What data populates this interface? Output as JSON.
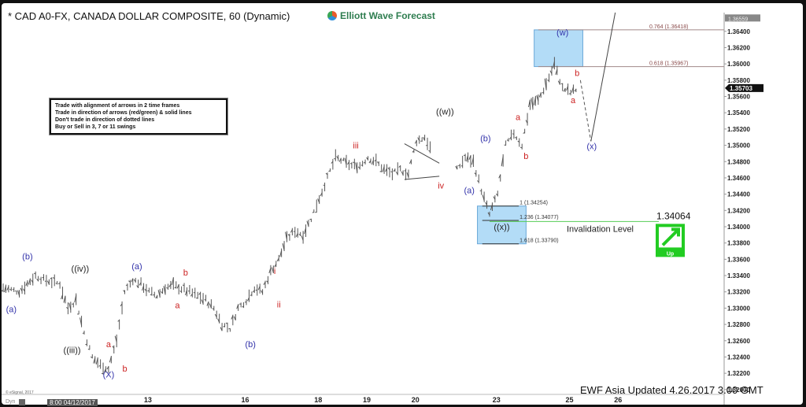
{
  "window": {
    "title": "* CAD A0-FX, CANADA DOLLAR COMPOSITE, 60 (Dynamic)",
    "brand": "Elliott Wave Forecast",
    "copyright": "© eSignal, 2017",
    "dyn_label": "Dyn",
    "cursor_date": "8:00 04/12/2017",
    "footer_note": "EWF Asia Updated 4.26.2017 3.00 GMT"
  },
  "rules_box": [
    "Trade with alignment of arrows in 2 time frames",
    "Trade in direction of arrows (red/green) & solid lines",
    "Don't trade in direction of dotted lines",
    "Buy or Sell in 3, 7 or 11 swings"
  ],
  "chart_data": {
    "type": "bar",
    "subtype": "ohlc-hourly",
    "title": "* CAD A0-FX, CANADA DOLLAR COMPOSITE, 60 (Dynamic)",
    "ylim": [
      1.3195,
      1.3663
    ],
    "y_ticks": [
      "1.36400",
      "1.36200",
      "1.36000",
      "1.35800",
      "1.35600",
      "1.35400",
      "1.35200",
      "1.35000",
      "1.34800",
      "1.34600",
      "1.34400",
      "1.34200",
      "1.34000",
      "1.33800",
      "1.33600",
      "1.33400",
      "1.33200",
      "1.33000",
      "1.32800",
      "1.32600",
      "1.32400",
      "1.32200",
      "1.32000"
    ],
    "x_ticks": [
      {
        "label": "13",
        "idx": 13
      },
      {
        "label": "16",
        "idx": 25
      },
      {
        "label": "18",
        "idx": 34
      },
      {
        "label": "19",
        "idx": 40
      },
      {
        "label": "20",
        "idx": 46
      },
      {
        "label": "23",
        "idx": 56
      },
      {
        "label": "25",
        "idx": 65
      },
      {
        "label": "26",
        "idx": 71
      }
    ],
    "price_path": [
      [
        0,
        1.3325
      ],
      [
        2,
        1.332
      ],
      [
        4,
        1.334
      ],
      [
        5,
        1.3335
      ],
      [
        7,
        1.333
      ],
      [
        8,
        1.33
      ],
      [
        9,
        1.331
      ],
      [
        10,
        1.327
      ],
      [
        11,
        1.324
      ],
      [
        12,
        1.323
      ],
      [
        13,
        1.3225
      ],
      [
        14,
        1.326
      ],
      [
        15,
        1.332
      ],
      [
        16,
        1.3335
      ],
      [
        17,
        1.333
      ],
      [
        18,
        1.332
      ],
      [
        19,
        1.3315
      ],
      [
        20,
        1.3325
      ],
      [
        21,
        1.3328
      ],
      [
        23,
        1.332
      ],
      [
        24,
        1.3315
      ],
      [
        25,
        1.331
      ],
      [
        26,
        1.33
      ],
      [
        27,
        1.328
      ],
      [
        28,
        1.3275
      ],
      [
        29,
        1.33
      ],
      [
        30,
        1.331
      ],
      [
        31,
        1.3325
      ],
      [
        32,
        1.332
      ],
      [
        33,
        1.3345
      ],
      [
        34,
        1.336
      ],
      [
        35,
        1.3385
      ],
      [
        36,
        1.3395
      ],
      [
        37,
        1.339
      ],
      [
        38,
        1.341
      ],
      [
        39,
        1.3435
      ],
      [
        40,
        1.346
      ],
      [
        41,
        1.3485
      ],
      [
        42,
        1.348
      ],
      [
        43,
        1.3475
      ],
      [
        44,
        1.3475
      ],
      [
        45,
        1.3485
      ],
      [
        46,
        1.348
      ],
      [
        47,
        1.347
      ],
      [
        48,
        1.3465
      ],
      [
        49,
        1.347
      ],
      [
        50,
        1.3465
      ],
      [
        51,
        1.3505
      ],
      [
        52,
        1.351
      ],
      [
        53,
        1.349
      ],
      [
        56,
        1.347
      ],
      [
        57,
        1.3485
      ],
      [
        58,
        1.348
      ],
      [
        59,
        1.3445
      ],
      [
        60,
        1.3415
      ],
      [
        61,
        1.344
      ],
      [
        62,
        1.35
      ],
      [
        63,
        1.3515
      ],
      [
        64,
        1.35
      ],
      [
        65,
        1.355
      ],
      [
        66,
        1.3555
      ],
      [
        67,
        1.3575
      ],
      [
        68,
        1.36
      ],
      [
        69,
        1.357
      ],
      [
        70,
        1.3565
      ],
      [
        71,
        1.357
      ]
    ],
    "current_price": {
      "label": "1.35703",
      "value": 1.35703
    },
    "last_high": {
      "label": "1.36559",
      "value": 1.36559
    },
    "fib_levels": [
      {
        "label": "0.764 (1.36418)",
        "value": 1.36418
      },
      {
        "label": "0.618 (1.35967)",
        "value": 1.35967
      },
      {
        "label": "1 (1.34254)",
        "value": 1.34254
      },
      {
        "label": "1.236 (1.34077)",
        "value": 1.34077
      },
      {
        "label": "1.618 (1.33790)",
        "value": 1.3379
      }
    ],
    "zones": [
      {
        "name": "w-target-zone",
        "from_idx": 65.5,
        "to_idx": 71.5,
        "low": 1.35967,
        "high": 1.36418
      },
      {
        "name": "xx-buy-zone",
        "from_idx": 58.5,
        "to_idx": 64.5,
        "low": 1.3379,
        "high": 1.34254
      }
    ],
    "invalidation": {
      "label": "Invalidation Level",
      "value_label": "1.34064",
      "value": 1.34064,
      "direction": "Up",
      "color": "#22cc22"
    },
    "projection": {
      "dashed": [
        [
          71.2,
          1.358
        ],
        [
          72.5,
          1.3505
        ]
      ],
      "solid": [
        [
          72.5,
          1.3505
        ],
        [
          75.5,
          1.3665
        ]
      ]
    },
    "triangle": {
      "upper": [
        [
          49.5,
          1.3502
        ],
        [
          53.8,
          1.3478
        ]
      ],
      "lower": [
        [
          49.5,
          1.3458
        ],
        [
          53.8,
          1.3462
        ]
      ]
    },
    "wave_labels": [
      {
        "text": "(a)",
        "idx": 1,
        "value": 1.3295,
        "color": "#3333aa"
      },
      {
        "text": "(b)",
        "idx": 3,
        "value": 1.336,
        "color": "#3333aa"
      },
      {
        "text": "((iv))",
        "idx": 9.5,
        "value": 1.3345,
        "color": "#222222"
      },
      {
        "text": "((iii))",
        "idx": 8.5,
        "value": 1.3245,
        "color": "#222222"
      },
      {
        "text": "a",
        "idx": 13,
        "value": 1.3252,
        "color": "#cc2222"
      },
      {
        "text": "(X)",
        "idx": 13,
        "value": 1.3215,
        "color": "#3333aa"
      },
      {
        "text": "b",
        "idx": 15,
        "value": 1.3222,
        "color": "#cc2222"
      },
      {
        "text": "(a)",
        "idx": 16.5,
        "value": 1.3348,
        "color": "#3333aa"
      },
      {
        "text": "b",
        "idx": 22.5,
        "value": 1.334,
        "color": "#cc2222"
      },
      {
        "text": "a",
        "idx": 21.5,
        "value": 1.33,
        "color": "#cc2222"
      },
      {
        "text": "(b)",
        "idx": 30.5,
        "value": 1.3252,
        "color": "#3333aa"
      },
      {
        "text": "i",
        "idx": 33.5,
        "value": 1.3342,
        "color": "#cc2222"
      },
      {
        "text": "ii",
        "idx": 34,
        "value": 1.3301,
        "color": "#cc2222"
      },
      {
        "text": "iii",
        "idx": 43.5,
        "value": 1.3496,
        "color": "#cc2222"
      },
      {
        "text": "iv",
        "idx": 54,
        "value": 1.3447,
        "color": "#cc2222"
      },
      {
        "text": "((w))",
        "idx": 54.5,
        "value": 1.3538,
        "color": "#222222"
      },
      {
        "text": "(a)",
        "idx": 57.5,
        "value": 1.3441,
        "color": "#3333aa"
      },
      {
        "text": "(b)",
        "idx": 59.5,
        "value": 1.3505,
        "color": "#3333aa"
      },
      {
        "text": "((x))",
        "idx": 61.5,
        "value": 1.3396,
        "color": "#222222"
      },
      {
        "text": "a",
        "idx": 63.5,
        "value": 1.3531,
        "color": "#cc2222"
      },
      {
        "text": "b",
        "idx": 64.5,
        "value": 1.3483,
        "color": "#cc2222"
      },
      {
        "text": "(w)",
        "idx": 69,
        "value": 1.3635,
        "color": "#3333aa"
      },
      {
        "text": "b",
        "idx": 70.8,
        "value": 1.3585,
        "color": "#cc2222"
      },
      {
        "text": "a",
        "idx": 70.3,
        "value": 1.3552,
        "color": "#cc2222"
      },
      {
        "text": "(x)",
        "idx": 72.6,
        "value": 1.3495,
        "color": "#3333aa"
      }
    ],
    "xlabel": "",
    "ylabel": "",
    "grid": false
  }
}
